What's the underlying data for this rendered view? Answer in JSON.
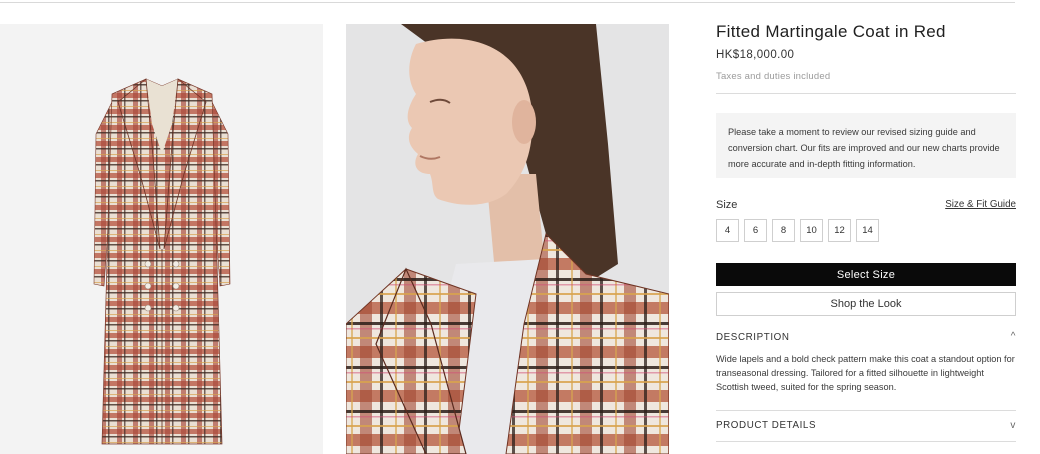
{
  "product": {
    "title": "Fitted Martingale Coat in Red",
    "price": "HK$18,000.00",
    "tax_note": "Taxes and duties included"
  },
  "notice": "Please take a moment to review our revised sizing guide and conversion chart. Our fits are improved and our new charts provide more accurate and in-depth fitting information.",
  "size": {
    "label": "Size",
    "guide_link": "Size & Fit Guide",
    "options": [
      "4",
      "6",
      "8",
      "10",
      "12",
      "14"
    ]
  },
  "actions": {
    "select_size": "Select Size",
    "shop_look": "Shop the Look"
  },
  "description": {
    "heading": "DESCRIPTION",
    "toggle": "^",
    "text": "Wide lapels and a bold check pattern make this coat a standout option for transeasonal dressing. Tailored for a fitted silhouette in lightweight Scottish tweed, suited for the spring season."
  },
  "product_details": {
    "heading": "PRODUCT DETAILS",
    "toggle": "v"
  },
  "images": {
    "coat_icon": "coat-flatlay-image",
    "model_icon": "model-profile-image"
  }
}
